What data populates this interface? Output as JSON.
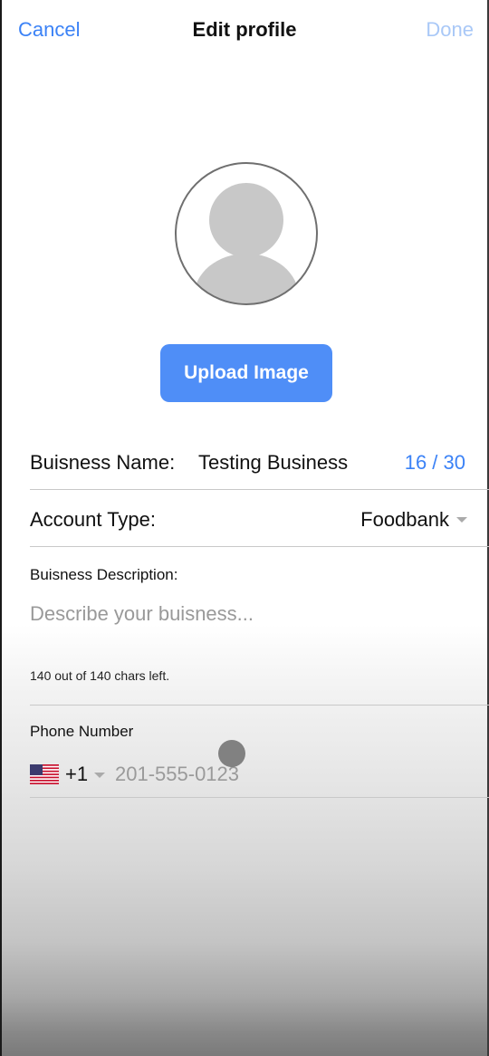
{
  "nav": {
    "cancel": "Cancel",
    "title": "Edit profile",
    "done": "Done"
  },
  "avatar": {
    "icon": "person-placeholder-icon"
  },
  "upload": {
    "label": "Upload Image"
  },
  "business_name": {
    "label": "Buisness Name:",
    "value": "Testing Business",
    "counter": "16 / 30"
  },
  "account_type": {
    "label": "Account Type:",
    "value": "Foodbank"
  },
  "description": {
    "label": "Buisness Description:",
    "placeholder": "Describe your buisness...",
    "counter": "140 out of 140 chars left."
  },
  "phone": {
    "label": "Phone Number",
    "flag_icon": "us-flag-icon",
    "country_code": "+1",
    "placeholder": "201-555-0123"
  },
  "colors": {
    "accent": "#3b82f6",
    "done_disabled": "#a9c8f7",
    "button": "#4f8ef7"
  }
}
